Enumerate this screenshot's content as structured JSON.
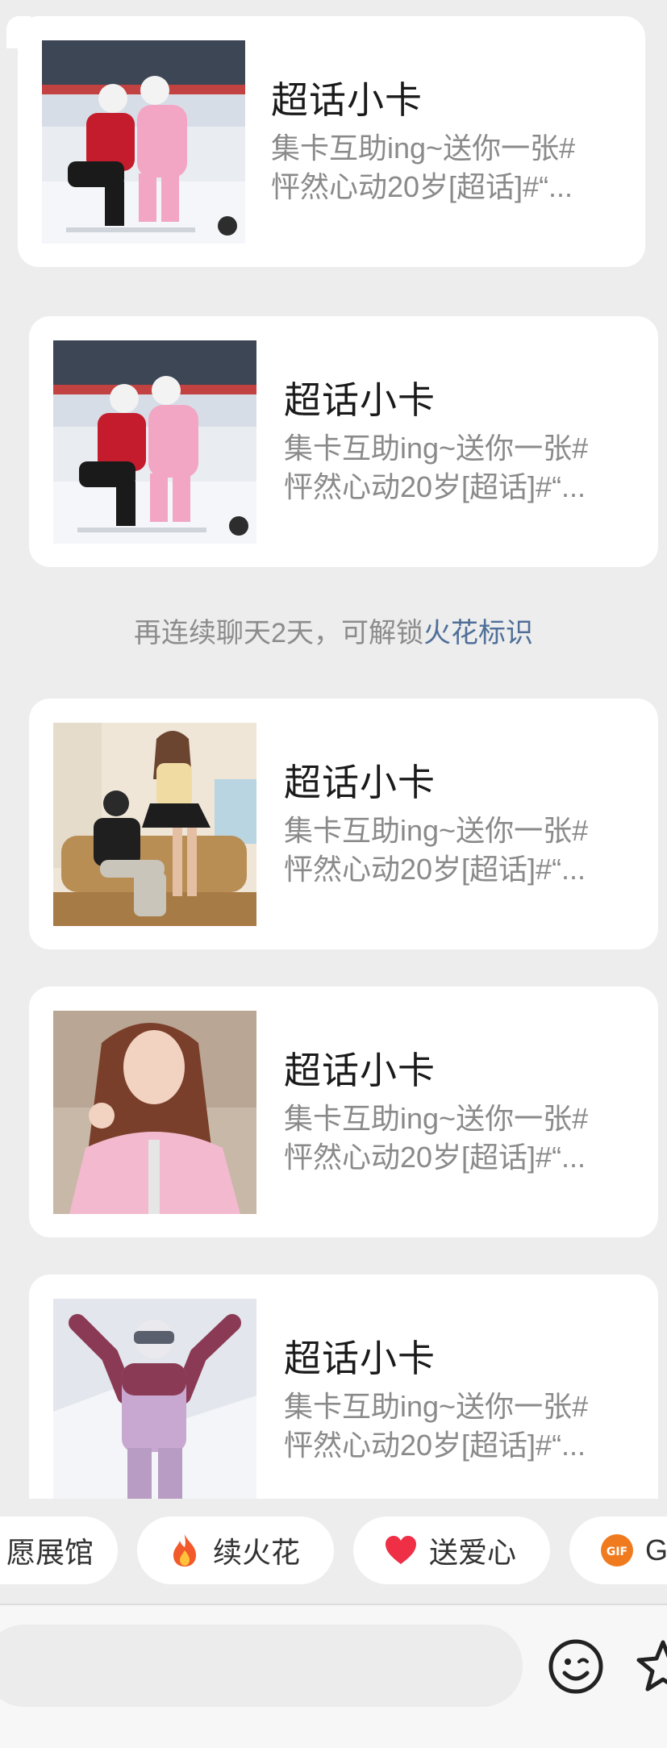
{
  "messages": [
    {
      "title": "超话小卡",
      "desc_line1": "集卡互助ing~送你一张#",
      "desc_line2": "怦然心动20岁[超话]#“...",
      "image": "couple-snowboard"
    },
    {
      "title": "超话小卡",
      "desc_line1": "集卡互助ing~送你一张#",
      "desc_line2": "怦然心动20岁[超话]#“...",
      "image": "couple-snowboard"
    },
    {
      "title": "超话小卡",
      "desc_line1": "集卡互助ing~送你一张#",
      "desc_line2": "怦然心动20岁[超话]#“...",
      "image": "couple-hay"
    },
    {
      "title": "超话小卡",
      "desc_line1": "集卡互助ing~送你一张#",
      "desc_line2": "怦然心动20岁[超话]#“...",
      "image": "girl-pink-jacket"
    },
    {
      "title": "超话小卡",
      "desc_line1": "集卡互助ing~送你一张#",
      "desc_line2": "怦然心动20岁[超话]#“...",
      "image": "girl-ski"
    }
  ],
  "system_note": {
    "text": "再连续聊天2天，可解锁",
    "link": "火花标识"
  },
  "quick_actions": {
    "wish": "愿展馆",
    "spark": "续火花",
    "heart": "送爱心",
    "gif": "G",
    "gif_badge": "GIF"
  },
  "input": {
    "placeholder": ""
  },
  "colors": {
    "background": "#ededed",
    "bubble": "#ffffff",
    "link": "#4f6f99"
  }
}
